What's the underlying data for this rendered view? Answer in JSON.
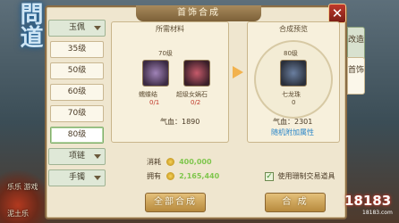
{
  "window": {
    "title": "首饰合成"
  },
  "left_menu": {
    "category": "玉佩",
    "levels": [
      "35级",
      "50级",
      "60级",
      "70级",
      "80级"
    ],
    "selected_level": "80级",
    "other_categories": [
      "项链",
      "手镯"
    ]
  },
  "materials": {
    "header": "所需材料",
    "level": "70级",
    "items": [
      {
        "name": "蠕蝶结",
        "count": "0/1"
      },
      {
        "name": "超级女娲石",
        "count": "0/2"
      }
    ],
    "stat": "气血：1890"
  },
  "preview": {
    "header": "合成预览",
    "level": "80级",
    "name": "七龙珠",
    "count": "0",
    "stat": "气血：2301",
    "link": "随机附加属性"
  },
  "side_tabs": [
    "改造",
    "首饰"
  ],
  "cost": {
    "consume_label": "消耗",
    "consume_value": "400,000",
    "have_label": "拥有",
    "have_value": "2,165,440"
  },
  "checkbox": {
    "label": "使用珊制交易道具",
    "checked": true
  },
  "buttons": {
    "compose_all": "全部合成",
    "compose": "合 成"
  },
  "background_text": {
    "left1": "乐乐 游戏",
    "left2": "泥土乐"
  },
  "watermark": {
    "main": "18183",
    "sub": "18183.com"
  },
  "colors": {
    "accent": "#7fc64d",
    "close": "#c0392b",
    "link": "#2a86c9"
  }
}
